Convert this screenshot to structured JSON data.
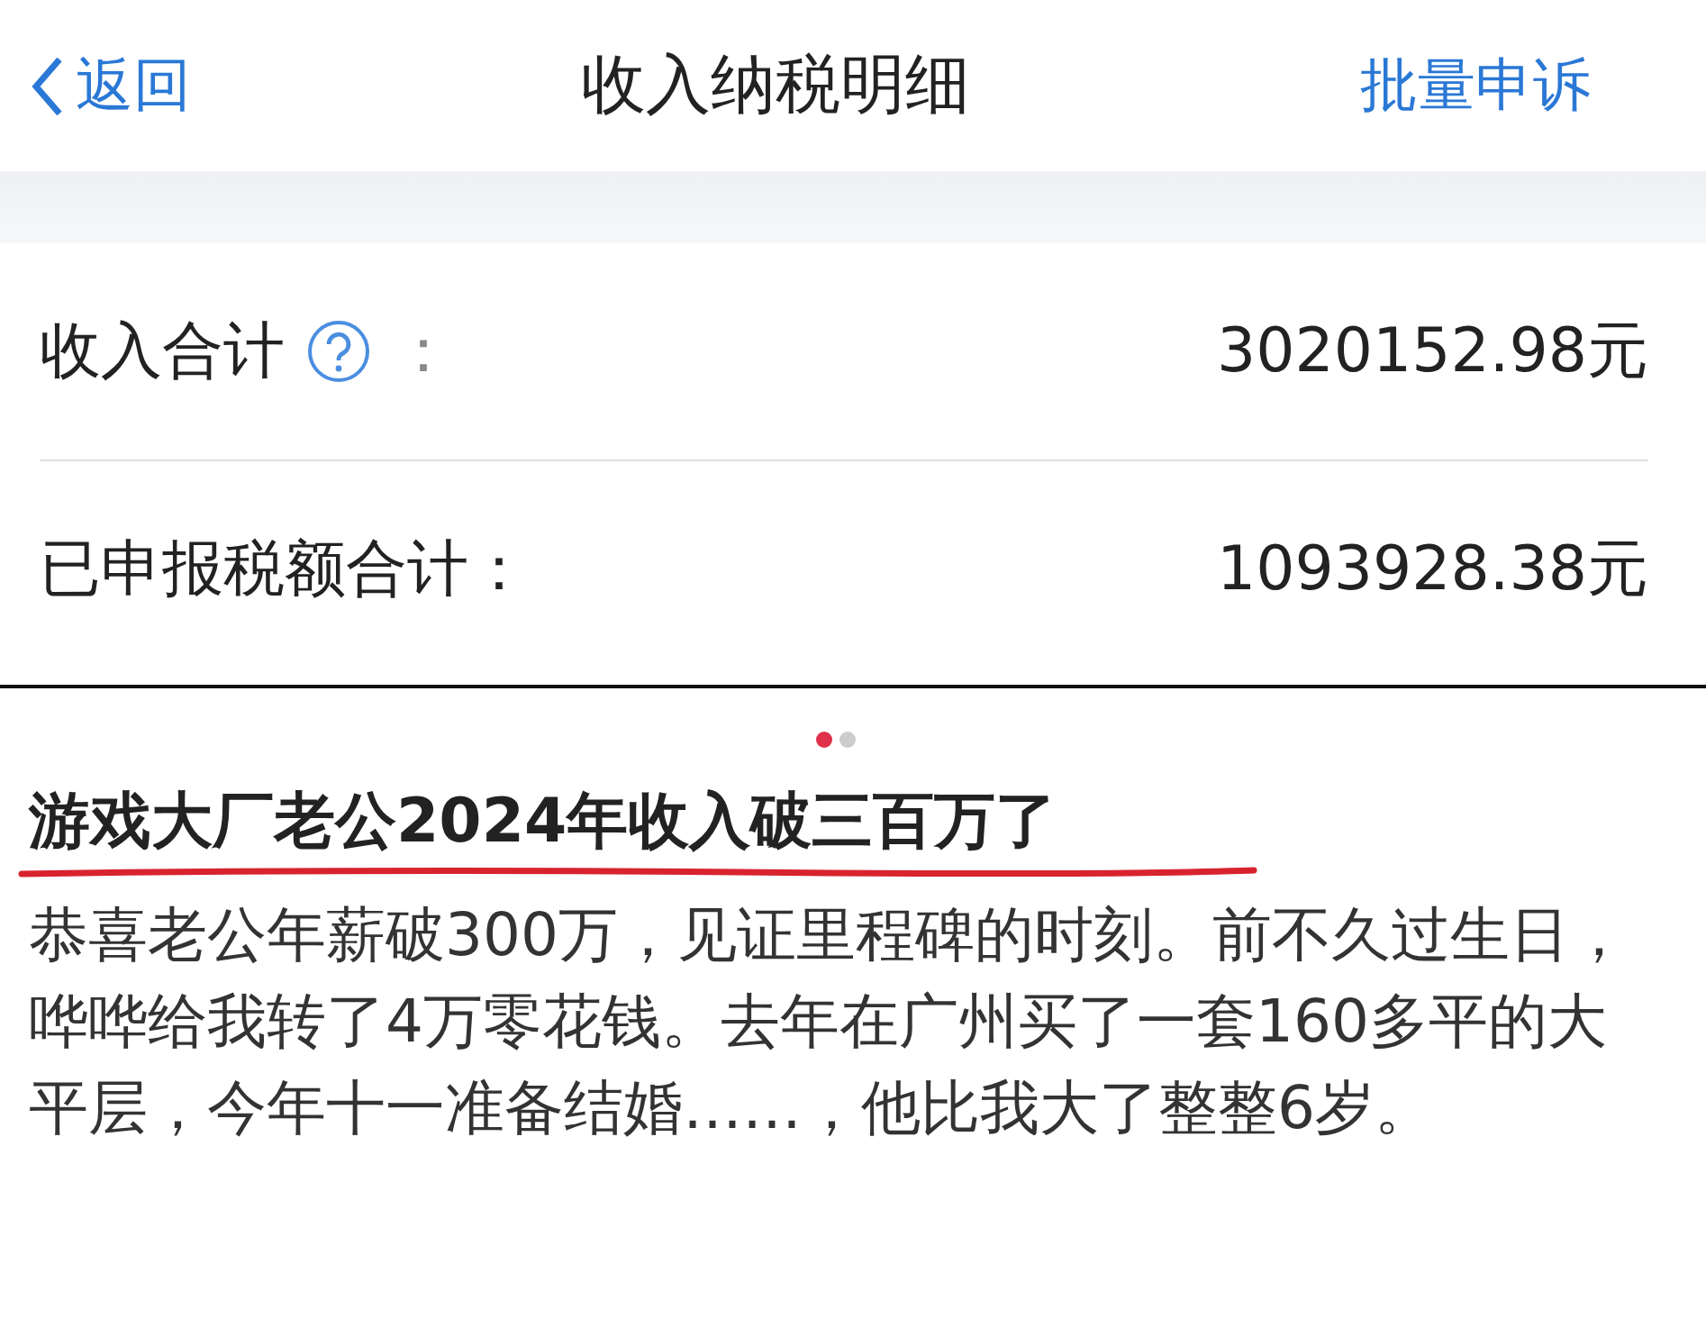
{
  "nav": {
    "back": "返回",
    "title": "收入纳税明细",
    "action": "批量申诉"
  },
  "summary": [
    {
      "label": "收入合计",
      "help": true,
      "colon": "：",
      "value": "3020152.98元"
    },
    {
      "label": "已申报税额合计",
      "help": false,
      "colon": "：",
      "value": "1093928.38元"
    }
  ],
  "pager": [
    {
      "selected": true
    },
    {
      "selected": false
    }
  ],
  "post": {
    "title": "游戏大厂老公2024年收入破三百万了",
    "body": "恭喜老公年薪破300万，见证里程碑的时刻。前不久过生日，哗哗给我转了4万零花钱。去年在广州买了一套160多平的大平层，今年十一准备结婚……，他比我大了整整6岁。"
  }
}
